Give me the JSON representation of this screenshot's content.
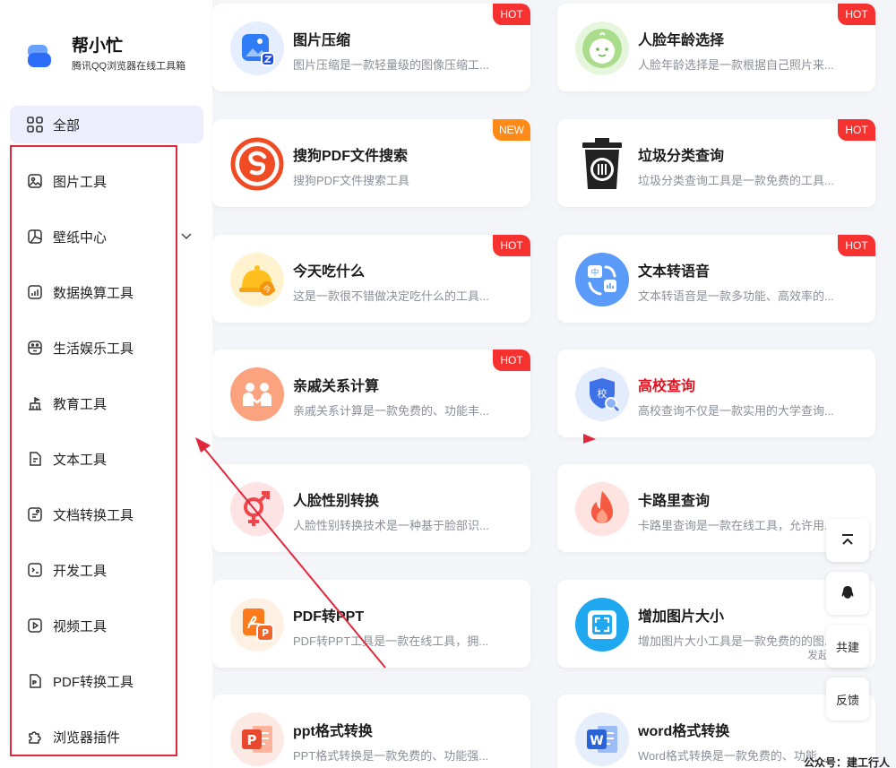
{
  "brand": {
    "name": "帮小忙",
    "subtitle": "腾讯QQ浏览器在线工具箱"
  },
  "sidebar": {
    "all_label": "全部",
    "items": [
      {
        "label": "图片工具",
        "icon": "image-icon"
      },
      {
        "label": "壁纸中心",
        "icon": "wallpaper-icon"
      },
      {
        "label": "数据换算工具",
        "icon": "chart-icon"
      },
      {
        "label": "生活娱乐工具",
        "icon": "entertainment-icon"
      },
      {
        "label": "教育工具",
        "icon": "education-icon"
      },
      {
        "label": "文本工具",
        "icon": "text-icon"
      },
      {
        "label": "文档转换工具",
        "icon": "document-icon"
      },
      {
        "label": "开发工具",
        "icon": "code-icon"
      },
      {
        "label": "视频工具",
        "icon": "video-icon"
      },
      {
        "label": "PDF转换工具",
        "icon": "pdf-icon"
      },
      {
        "label": "浏览器插件",
        "icon": "plugin-icon"
      }
    ]
  },
  "cards": [
    {
      "title": "图片压缩",
      "desc": "图片压缩是一款轻量级的图像压缩工...",
      "badge": "HOT",
      "icon": "image-compress-icon"
    },
    {
      "title": "人脸年龄选择",
      "desc": "人脸年龄选择是一款根据自己照片来...",
      "badge": "HOT",
      "icon": "baby-face-icon"
    },
    {
      "title": "搜狗PDF文件搜索",
      "desc": "搜狗PDF文件搜索工具",
      "badge": "NEW",
      "icon": "sogou-icon"
    },
    {
      "title": "垃圾分类查询",
      "desc": "垃圾分类查询工具是一款免费的工具...",
      "badge": "HOT",
      "icon": "trash-bin-icon"
    },
    {
      "title": "今天吃什么",
      "desc": "这是一款很不错做决定吃什么的工具...",
      "badge": "HOT",
      "icon": "food-bell-icon"
    },
    {
      "title": "文本转语音",
      "desc": "文本转语音是一款多功能、高效率的...",
      "badge": "HOT",
      "icon": "text-to-speech-icon"
    },
    {
      "title": "亲戚关系计算",
      "desc": "亲戚关系计算是一款免费的、功能丰...",
      "badge": "HOT",
      "icon": "relatives-icon"
    },
    {
      "title": "高校查询",
      "desc": "高校查询不仅是一款实用的大学查询...",
      "badge": "",
      "icon": "school-search-icon"
    },
    {
      "title": "人脸性别转换",
      "desc": "人脸性别转换技术是一种基于脸部识...",
      "badge": "",
      "icon": "gender-icon"
    },
    {
      "title": "卡路里查询",
      "desc": "卡路里查询是一款在线工具，允许用...",
      "badge": "",
      "icon": "flame-icon"
    },
    {
      "title": "PDF转PPT",
      "desc": "PDF转PPT工具是一款在线工具，拥...",
      "badge": "",
      "icon": "pdf-ppt-icon"
    },
    {
      "title": "增加图片大小",
      "desc": "增加图片大小工具是一款免费的的图...",
      "badge": "",
      "icon": "image-enlarge-icon"
    },
    {
      "title": "ppt格式转换",
      "desc": "PPT格式转换是一款免费的、功能强...",
      "badge": "",
      "icon": "ppt-icon"
    },
    {
      "title": "word格式转换",
      "desc": "Word格式转换是一款免费的、功能...",
      "badge": "",
      "icon": "word-icon"
    }
  ],
  "float": {
    "top_label": "",
    "qq_label": "",
    "cobuild_label": "共建",
    "feedback_label": "反馈",
    "behind_text": "发起"
  },
  "watermark": "公众号：建工行人",
  "colors": {
    "accent": "#2d6cf6",
    "hot": "#f5322f",
    "new": "#ff8a18",
    "highlight_box": "#e0283b"
  }
}
